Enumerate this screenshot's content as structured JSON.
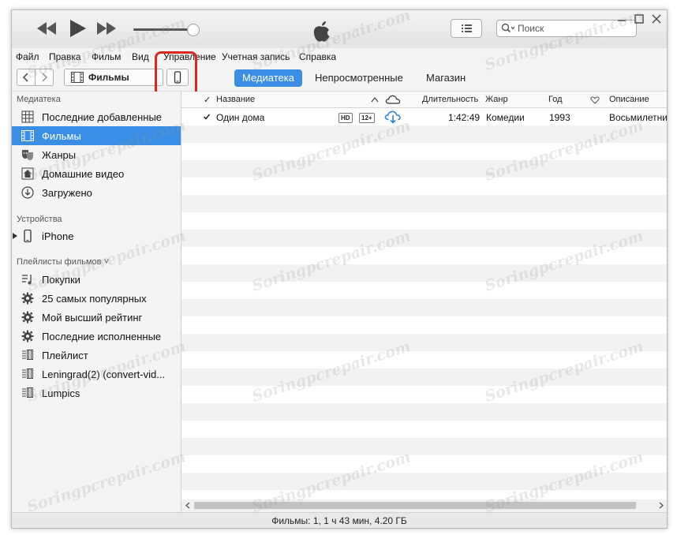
{
  "app": {
    "search_placeholder": "Поиск"
  },
  "menu": [
    "Файл",
    "Правка",
    "Фильм",
    "Вид",
    "Управление",
    "Учетная запись",
    "Справка"
  ],
  "toolbar": {
    "media_selector": "Фильмы",
    "tabs": [
      "Медиатека",
      "Непросмотренные",
      "Магазин"
    ],
    "active_tab": "Медиатека"
  },
  "sidebar": {
    "library_title": "Медиатека",
    "library_items": [
      {
        "label": "Последние добавленные",
        "icon": "grid-icon"
      },
      {
        "label": "Фильмы",
        "icon": "film-icon"
      },
      {
        "label": "Жанры",
        "icon": "masks-icon"
      },
      {
        "label": "Домашние видео",
        "icon": "home-video-icon"
      },
      {
        "label": "Загружено",
        "icon": "download-icon"
      }
    ],
    "active_item": "Фильмы",
    "devices_title": "Устройства",
    "devices": [
      {
        "label": "iPhone",
        "icon": "iphone-icon"
      }
    ],
    "playlists_title": "Плейлисты фильмов ˅",
    "playlists": [
      {
        "label": "Покупки",
        "icon": "purchases-icon"
      },
      {
        "label": "25 самых популярных",
        "icon": "gear-icon"
      },
      {
        "label": "Мой высший рейтинг",
        "icon": "gear-icon"
      },
      {
        "label": "Последние исполненные",
        "icon": "gear-icon"
      },
      {
        "label": "Плейлист",
        "icon": "playlist-icon"
      },
      {
        "label": "Leningrad(2)  (convert-vid...",
        "icon": "playlist-icon"
      },
      {
        "label": "Lumpics",
        "icon": "playlist-icon"
      }
    ]
  },
  "table": {
    "columns": {
      "check": "✓",
      "name": "Название",
      "duration": "Длительность",
      "genre": "Жанр",
      "year": "Год",
      "description": "Описание"
    },
    "rows": [
      {
        "name": "Один дома",
        "hd": "HD",
        "rating": "12+",
        "duration": "1:42:49",
        "genre": "Комедии",
        "year": "1993",
        "description": "Восьмилетний"
      }
    ]
  },
  "status": "Фильмы: 1, 1 ч 43 мин, 4.20 ГБ",
  "watermark": "Soringpcrepair.com",
  "colors": {
    "accent": "#3a8ee6",
    "highlight": "#d8281f"
  }
}
